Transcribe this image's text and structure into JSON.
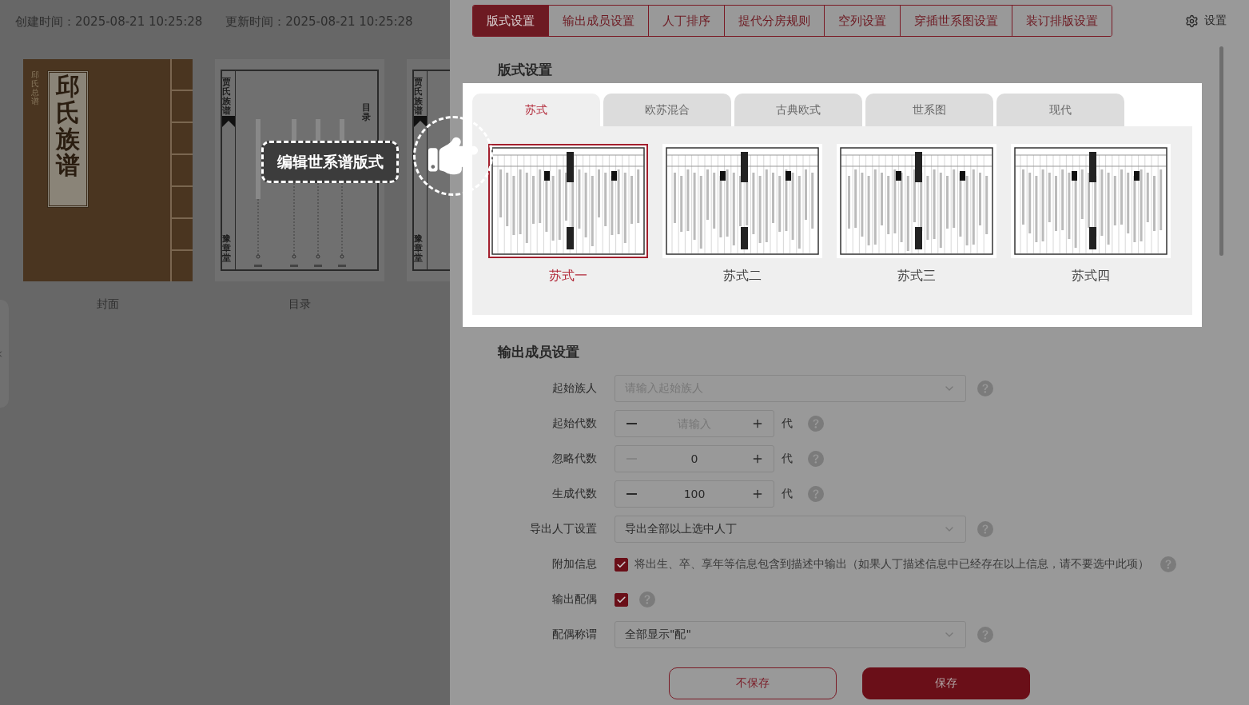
{
  "left": {
    "created": "创建时间：2025-08-21 10:25:28",
    "updated": "更新时间：2025-08-21 10:25:28",
    "pages": [
      {
        "kind": "cover",
        "title": "邱氏族谱",
        "subtitle": "邱氏总谱",
        "label": "封面"
      },
      {
        "kind": "toc",
        "spine": "贾氏族谱",
        "heading": "目录",
        "hall": "豫章堂",
        "label": "目录"
      },
      {
        "kind": "page",
        "spine": "贾氏族谱",
        "hall": "豫章堂"
      }
    ]
  },
  "callout": {
    "text": "编辑世系谱版式"
  },
  "tabs": [
    {
      "label": "版式设置",
      "selected": true
    },
    {
      "label": "输出成员设置",
      "selected": false
    },
    {
      "label": "人丁排序",
      "selected": false
    },
    {
      "label": "提代分房规则",
      "selected": false
    },
    {
      "label": "空列设置",
      "selected": false
    },
    {
      "label": "穿插世系图设置",
      "selected": false
    },
    {
      "label": "装订排版设置",
      "selected": false
    }
  ],
  "settings": "设置",
  "layout_section": {
    "title": "版式设置",
    "styles": [
      {
        "label": "苏式",
        "selected": true
      },
      {
        "label": "欧苏混合",
        "selected": false
      },
      {
        "label": "古典欧式",
        "selected": false
      },
      {
        "label": "世系图",
        "selected": false
      },
      {
        "label": "现代",
        "selected": false
      }
    ],
    "layouts": [
      {
        "name": "苏式一",
        "selected": true
      },
      {
        "name": "苏式二",
        "selected": false
      },
      {
        "name": "苏式三",
        "selected": false
      },
      {
        "name": "苏式四",
        "selected": false
      }
    ]
  },
  "members_section": {
    "title": "输出成员设置",
    "rows": [
      {
        "kind": "select",
        "label": "起始族人",
        "placeholder": "请输入起始族人"
      },
      {
        "kind": "stepper",
        "label": "起始代数",
        "placeholder": "请输入",
        "unit": "代",
        "minus_disabled": false
      },
      {
        "kind": "stepper",
        "label": "忽略代数",
        "value": "0",
        "unit": "代",
        "minus_disabled": true
      },
      {
        "kind": "stepper",
        "label": "生成代数",
        "value": "100",
        "unit": "代",
        "minus_disabled": false
      },
      {
        "kind": "select",
        "label": "导出人丁设置",
        "value": "导出全部以上选中人丁"
      },
      {
        "kind": "checkbox",
        "label": "附加信息",
        "checked": true,
        "text": "将出生、卒、享年等信息包含到描述中输出（如果人丁描述信息中已经存在以上信息，请不要选中此项）"
      },
      {
        "kind": "checkbox",
        "label": "输出配偶",
        "checked": true
      },
      {
        "kind": "select",
        "label": "配偶称谓",
        "value": "全部显示\"配\""
      }
    ]
  },
  "footer": {
    "cancel": "不保存",
    "save": "保存"
  }
}
